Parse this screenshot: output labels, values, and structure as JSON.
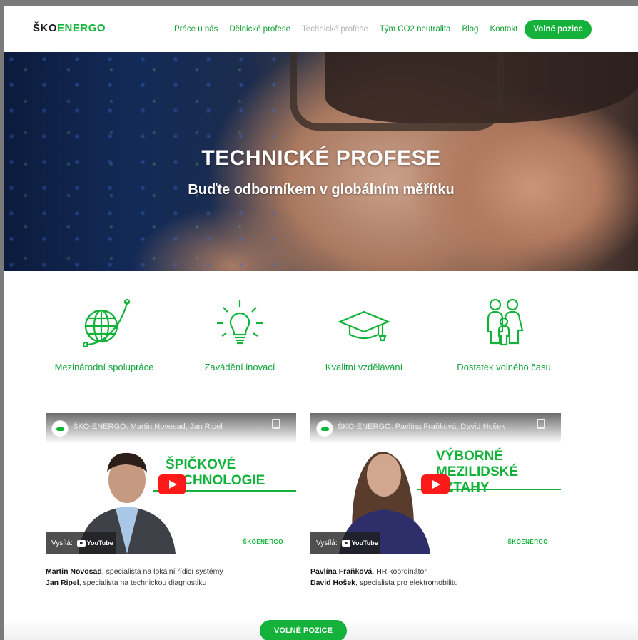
{
  "brand": {
    "logo_prefix": "ŠKO",
    "logo_suffix": "ENERGO",
    "accent": "#12b53a"
  },
  "nav": {
    "items": [
      {
        "label": "Práce u nás",
        "active": false
      },
      {
        "label": "Dělnické profese",
        "active": false
      },
      {
        "label": "Technické profese",
        "active": true
      },
      {
        "label": "Tým CO2 neutralita",
        "active": false
      },
      {
        "label": "Blog",
        "active": false
      },
      {
        "label": "Kontakt",
        "active": false
      }
    ],
    "cta_label": "Volné pozice"
  },
  "hero": {
    "title": "TECHNICKÉ PROFESE",
    "subtitle": "Buďte odborníkem v globálním měřítku"
  },
  "features": [
    {
      "icon": "globe-icon",
      "label": "Mezinárodní spolupráce"
    },
    {
      "icon": "lightbulb-icon",
      "label": "Zavádění inovací"
    },
    {
      "icon": "graduation-cap-icon",
      "label": "Kvalitní vzdělávání"
    },
    {
      "icon": "family-icon",
      "label": "Dostatek volného času"
    }
  ],
  "videos": [
    {
      "title": "ŠKO-ENERGO: Martin Novosad, Jan Ripel",
      "overlay_line1": "ŠPIČKOVÉ",
      "overlay_line2": "TECHNOLOGIE",
      "overlay_line3": "",
      "brand": "ŠKOENERGO",
      "watch_on": "Vysílá:",
      "platform": "YouTube",
      "people": [
        {
          "name": "Martin Novosad",
          "role": ", specialista na lokální řídicí systémy"
        },
        {
          "name": "Jan Ripel",
          "role": ", specialista na technickou diagnostiku"
        }
      ]
    },
    {
      "title": "ŠKO-ENERGO: Pavlína Fraňková, David Hošek",
      "overlay_line1": "VÝBORNÉ",
      "overlay_line2": "MEZILIDSKÉ",
      "overlay_line3": "VZTAHY",
      "brand": "ŠKOENERGO",
      "watch_on": "Vysílá:",
      "platform": "YouTube",
      "people": [
        {
          "name": "Pavlína Fraňková",
          "role": ", HR koordinátor"
        },
        {
          "name": "David Hošek",
          "role": ", specialista pro elektromobilitu"
        }
      ]
    }
  ],
  "bottom_cta": {
    "label": "VOLNÉ POZICE"
  }
}
